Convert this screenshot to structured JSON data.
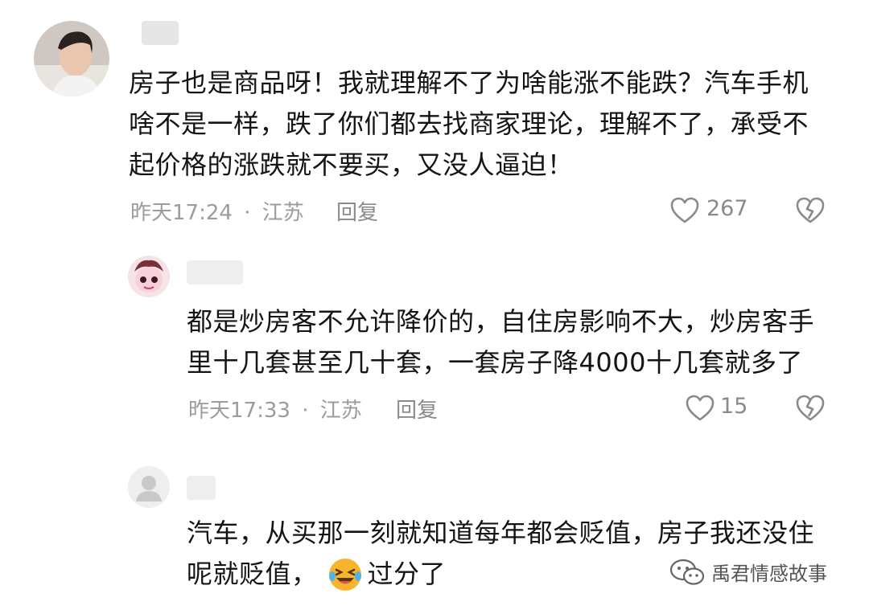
{
  "comments": [
    {
      "text_lines": [
        "房子也是商品呀！我就理解不了为啥能涨不能跌？汽车手机",
        "啥不是一样，跌了你们都去找商家理论，理解不了，承受不",
        "起价格的涨跌就不要买，又没人逼迫！"
      ],
      "time": "昨天17:24",
      "separator": "·",
      "location": "江苏",
      "reply_label": "回复",
      "likes": "267"
    },
    {
      "text_lines": [
        "都是炒房客不允许降价的，自住房影响不大，炒房客手",
        "里十几套甚至几十套，一套房子降4000十几套就多了"
      ],
      "time": "昨天17:33",
      "separator": "·",
      "location": "江苏",
      "reply_label": "回复",
      "likes": "15"
    },
    {
      "text_lines": [
        "汽车，从买那一刻就知道每年都会贬值，房子我还没住",
        "呢就贬值，"
      ],
      "text_after_emoji": "过分了"
    }
  ],
  "icons": {
    "like": "heart-outline-icon",
    "dislike": "broken-heart-icon",
    "emoji": "laughing-crying-emoji-icon",
    "watermark_logo": "wechat-icon"
  },
  "watermark": {
    "text": "禹君情感故事"
  },
  "colors": {
    "text": "#141414",
    "meta": "#9c9c9c",
    "icon": "#8a8a8a",
    "emoji": "#f7b52c"
  }
}
